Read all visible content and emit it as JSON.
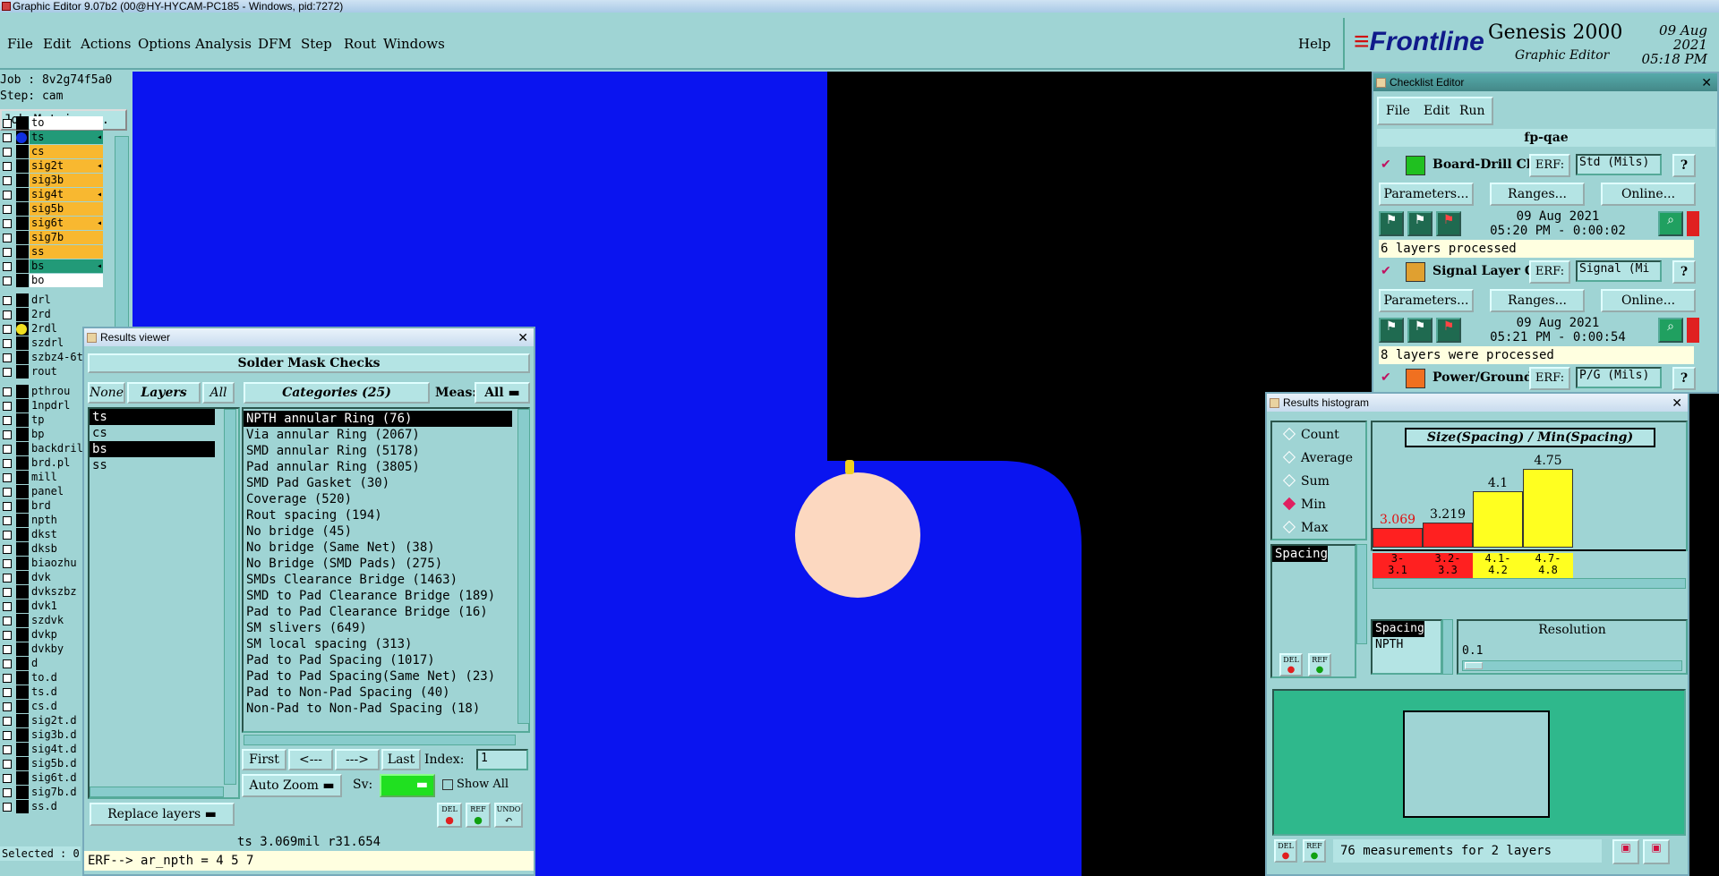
{
  "window": {
    "title": "Graphic Editor 9.07b2 (00@HY-HYCAM-PC185 - Windows, pid:7272)"
  },
  "menu": {
    "items": [
      "File",
      "Edit",
      "Actions",
      "Options",
      "Analysis",
      "DFM",
      "Step",
      "Rout",
      "Windows"
    ],
    "help": "Help"
  },
  "brand": {
    "logo": "Frontline",
    "product": "Genesis 2000",
    "subtitle": "Graphic Editor",
    "date": "09 Aug 2021",
    "time": "05:18 PM"
  },
  "job": {
    "job_line": "Job : 8v2g74f5a0",
    "step_line": "Step: cam",
    "matrix_button": "Job Matrix ..."
  },
  "layers": [
    {
      "name": "to",
      "color": "#ffffff",
      "marker": "",
      "arrow": ""
    },
    {
      "name": "ts",
      "color": "#229a78",
      "marker": "#1030e0",
      "arrow": "◂"
    },
    {
      "name": "cs",
      "color": "#f8b830",
      "marker": "",
      "arrow": ""
    },
    {
      "name": "sig2t",
      "color": "#f8b830",
      "marker": "",
      "arrow": "◂"
    },
    {
      "name": "sig3b",
      "color": "#f8b830",
      "marker": "",
      "arrow": ""
    },
    {
      "name": "sig4t",
      "color": "#f8b830",
      "marker": "",
      "arrow": "◂"
    },
    {
      "name": "sig5b",
      "color": "#f8b830",
      "marker": "",
      "arrow": ""
    },
    {
      "name": "sig6t",
      "color": "#f8b830",
      "marker": "",
      "arrow": "◂"
    },
    {
      "name": "sig7b",
      "color": "#f8b830",
      "marker": "",
      "arrow": ""
    },
    {
      "name": "ss",
      "color": "#f8b830",
      "marker": "",
      "arrow": ""
    },
    {
      "name": "bs",
      "color": "#229a78",
      "marker": "",
      "arrow": "◂"
    },
    {
      "name": "bo",
      "color": "#ffffff",
      "marker": "",
      "arrow": ""
    }
  ],
  "drill_layers": [
    {
      "name": "drl",
      "marker": ""
    },
    {
      "name": "2rd",
      "marker": ""
    },
    {
      "name": "2rdl",
      "marker": "#f0e020"
    },
    {
      "name": "szdrl",
      "marker": ""
    },
    {
      "name": "szbz4-6t",
      "marker": ""
    },
    {
      "name": "rout",
      "marker": ""
    }
  ],
  "other_layers": [
    "pthrou",
    "1npdrl",
    "tp",
    "bp",
    "backdril",
    "brd.pl",
    "mill",
    "panel",
    "brd",
    "npth",
    "dkst",
    "dksb",
    "biaozhu",
    "dvk",
    "dvkszbz",
    "dvk1",
    "szdvk",
    "dvkp",
    "dvkby",
    "d",
    "to.d",
    "ts.d",
    "cs.d",
    "sig2t.d",
    "sig3b.d",
    "sig4t.d",
    "sig5b.d",
    "sig6t.d",
    "sig7b.d",
    "ss.d"
  ],
  "selected_label": "Selected : 0",
  "results_viewer": {
    "title": "Results viewer",
    "header": "Solder Mask Checks",
    "none_btn": "None",
    "layers_btn": "Layers",
    "all_btn": "All",
    "categories_label": "Categories (25)",
    "meas_label": "Meas:",
    "meas_value": "All",
    "layer_list": [
      {
        "name": "ts",
        "selected": true
      },
      {
        "name": "cs",
        "selected": false
      },
      {
        "name": "bs",
        "selected": true
      },
      {
        "name": "ss",
        "selected": false
      }
    ],
    "categories": [
      {
        "name": "NPTH annular Ring (76)",
        "selected": true
      },
      {
        "name": "Via annular Ring (2067)",
        "selected": false
      },
      {
        "name": "SMD annular Ring (5178)",
        "selected": false
      },
      {
        "name": "Pad annular Ring (3805)",
        "selected": false
      },
      {
        "name": "SMD Pad Gasket (30)",
        "selected": false
      },
      {
        "name": "Coverage (520)",
        "selected": false
      },
      {
        "name": "Rout spacing (194)",
        "selected": false
      },
      {
        "name": "No bridge (45)",
        "selected": false
      },
      {
        "name": "No bridge (Same Net) (38)",
        "selected": false
      },
      {
        "name": "No Bridge (SMD Pads) (275)",
        "selected": false
      },
      {
        "name": "SMDs Clearance Bridge (1463)",
        "selected": false
      },
      {
        "name": "SMD to Pad Clearance Bridge (189)",
        "selected": false
      },
      {
        "name": "Pad to Pad Clearance Bridge (16)",
        "selected": false
      },
      {
        "name": "SM slivers (649)",
        "selected": false
      },
      {
        "name": "SM local spacing (313)",
        "selected": false
      },
      {
        "name": "Pad to Pad Spacing (1017)",
        "selected": false
      },
      {
        "name": "Pad to Pad Spacing(Same Net) (23)",
        "selected": false
      },
      {
        "name": "Pad to Non-Pad Spacing (40)",
        "selected": false
      },
      {
        "name": "Non-Pad to Non-Pad Spacing (18)",
        "selected": false
      }
    ],
    "first_btn": "First",
    "prev_btn": "<---",
    "next_btn": "--->",
    "last_btn": "Last",
    "index_label": "Index:",
    "index_value": "1",
    "zoom_value": "Auto Zoom",
    "sv_label": "Sv:",
    "show_all_label": "Show All",
    "replace_value": "Replace layers",
    "del_btn": "DEL",
    "ref_btn": "REF",
    "undo_btn": "UNDO",
    "status_line": "ts 3.069mil  r31.654",
    "erf_line": "ERF--> ar_npth = 4 5 7"
  },
  "checklist_editor": {
    "title": "Checklist Editor",
    "menu": [
      "File",
      "Edit",
      "Run"
    ],
    "checklist_name": "fp-qae",
    "erf_btn": "ERF:",
    "help_btn": "?",
    "params_btn": "Parameters...",
    "ranges_btn": "Ranges...",
    "online_btn": "Online...",
    "items": [
      {
        "name": "Board-Drill Che",
        "erf_value": "Std (Mils)",
        "date": "09 Aug 2021",
        "time": "05:20 PM - 0:00:02",
        "message": "6 layers processed",
        "icon_color": "#20c020"
      },
      {
        "name": "Signal Layer Ch",
        "erf_value": "Signal (Mi",
        "date": "09 Aug 2021",
        "time": "05:21 PM - 0:00:54",
        "message": "8 layers were processed",
        "icon_color": "#e0a030"
      },
      {
        "name": "Power/Ground C",
        "erf_value": "P/G (Mils)",
        "date": "",
        "time": "",
        "message": "",
        "icon_color": "#f07020"
      }
    ]
  },
  "histogram": {
    "title": "Results histogram",
    "modes": [
      {
        "label": "Count",
        "on": false
      },
      {
        "label": "Average",
        "on": false
      },
      {
        "label": "Sum",
        "on": false
      },
      {
        "label": "Min",
        "on": true
      },
      {
        "label": "Max",
        "on": false
      }
    ],
    "measure_list": [
      "Spacing"
    ],
    "type_list": [
      "Spacing",
      "NPTH"
    ],
    "resolution_label": "Resolution",
    "resolution_value": "0.1",
    "footer": "76 measurements for 2 layers",
    "del_btn": "DEL",
    "ref_btn": "REF",
    "chart_data": {
      "type": "bar",
      "title": "Size(Spacing) / Min(Spacing)",
      "categories": [
        "3-\n3.1",
        "3.2-\n3.3",
        "4.1-\n4.2",
        "4.7-\n4.8"
      ],
      "values": [
        3.069,
        3.219,
        4.1,
        4.75
      ],
      "value_labels": [
        "3.069",
        "3.219",
        "4.1",
        "4.75"
      ],
      "colors": [
        "#ff2020",
        "#ff2020",
        "#ffff20",
        "#ffff20"
      ],
      "value_label_colors": [
        "#e01010",
        "#000000",
        "#000000",
        "#000000"
      ],
      "ylim": [
        2.5,
        5
      ]
    }
  }
}
